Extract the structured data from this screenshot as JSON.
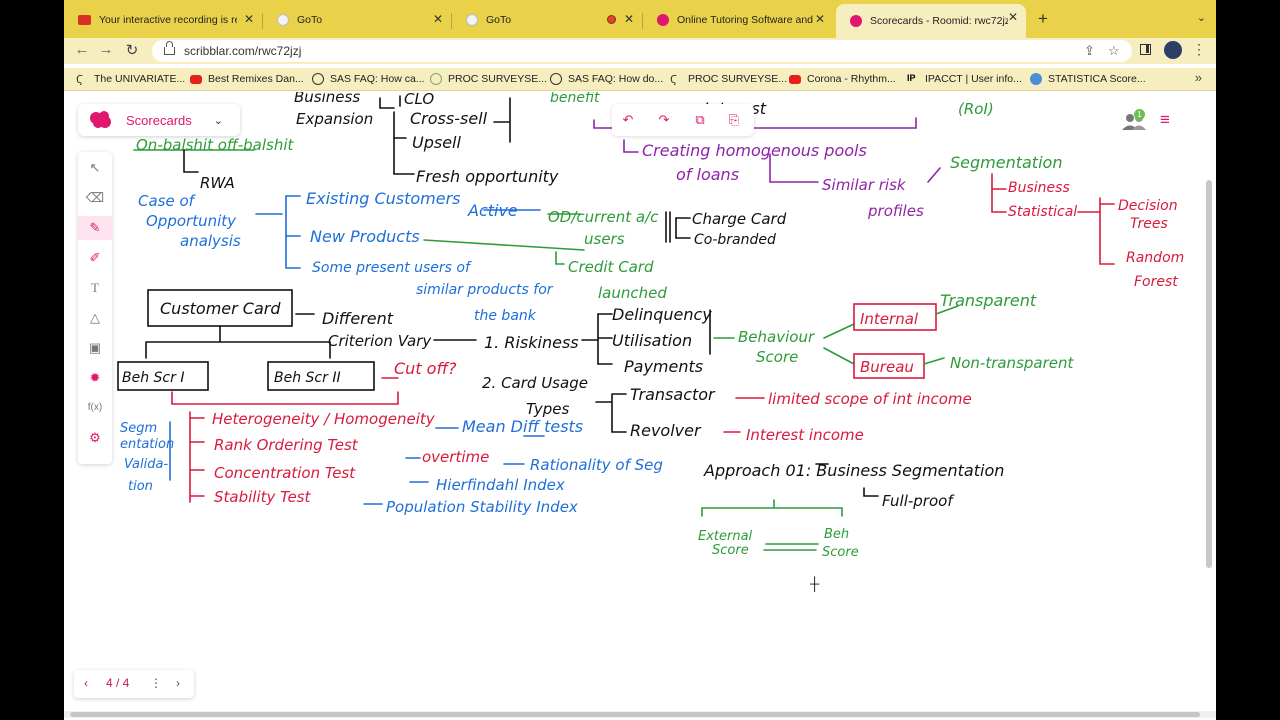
{
  "tabs": [
    {
      "title": "Your interactive recording is ready"
    },
    {
      "title": "GoTo"
    },
    {
      "title": "GoTo"
    },
    {
      "title": "Online Tutoring Software and"
    },
    {
      "title": "Scorecards - Roomid: rwc72jzj"
    }
  ],
  "browser": {
    "url": "scribblar.com/rwc72jzj"
  },
  "bookmarks": [
    "The UNIVARIATE...",
    "Best Remixes Dan...",
    "SAS FAQ: How ca...",
    "PROC SURVEYSE...",
    "SAS FAQ: How do...",
    "PROC SURVEYSE...",
    "Corona - Rhythm...",
    "IPACCT | User info...",
    "STATISTICA Score..."
  ],
  "app": {
    "room_name": "Scorecards",
    "participants": "1",
    "page": "4 / 4",
    "formula_label": "f(x)"
  },
  "board": {
    "business": "Business",
    "clo": "CLO",
    "expansion": "Expansion",
    "cross_sell": "Cross-sell",
    "upsell": "Upsell",
    "fresh_opportunity": "Fresh opportunity",
    "rwa": "RWA",
    "on_off_balance": "On-balshit  off-balshit",
    "benefit": "benefit",
    "interest": "Interest",
    "roi": "(RoI)",
    "homogenous": "Creating homogenous pools",
    "of_loans": "of loans",
    "similar_risk": "Similar risk",
    "profiles": "profiles",
    "segmentation": "Segmentation",
    "seg_business": "Business",
    "statistical": "Statistical",
    "decision": "Decision",
    "trees": "Trees",
    "random": "Random",
    "forest": "Forest",
    "case_of": "Case of",
    "opportunity": "Opportunity",
    "analysis": "analysis",
    "existing_customers": "Existing Customers",
    "active": "Active",
    "new_products": "New Products",
    "some_present": "Some present users of",
    "similar_products": "similar products for",
    "the_bank": "the bank",
    "od_current": "OD/current a/c",
    "users": "users",
    "charge_card": "Charge Card",
    "co_branded": "Co-branded",
    "credit_card": "Credit Card",
    "launched": "launched",
    "customer_card": "Customer Card",
    "different": "Different",
    "criterion_vary": "Criterion Vary",
    "riskiness": "1. Riskiness",
    "delinquency": "Delinquency",
    "utilisation": "Utilisation",
    "payments": "Payments",
    "behaviour": "Behaviour",
    "score": "Score",
    "internal": "Internal",
    "bureau": "Bureau",
    "transparent": "Transparent",
    "non_transparent": "Non-transparent",
    "beh_scr_1": "Beh Scr I",
    "beh_scr_2": "Beh Scr II",
    "cut_off": "Cut off?",
    "card_usage": "2. Card Usage",
    "types": "Types",
    "transactor": "Transactor",
    "revolver": "Revolver",
    "limited_scope": "limited scope of int income",
    "interest_income": "Interest income",
    "segm": "Segm",
    "entation": "entation",
    "valida": "Valida-",
    "tion": "tion",
    "heterogeneity": "Heterogeneity / Homogeneity",
    "mean_diff": "Mean Diff tests",
    "rank_ordering": "Rank Ordering Test",
    "overtime": "overtime",
    "rationality": "Rationality of Seg",
    "concentration": "Concentration Test",
    "hierfindahl": "Hierfindahl Index",
    "stability_test": "Stability Test",
    "psi": "Population Stability Index",
    "approach": "Approach 01: Business Segmentation",
    "fullproof": "Full-proof",
    "external": "External",
    "score_ext": "Score",
    "beh": "Beh",
    "score_beh": "Score"
  }
}
